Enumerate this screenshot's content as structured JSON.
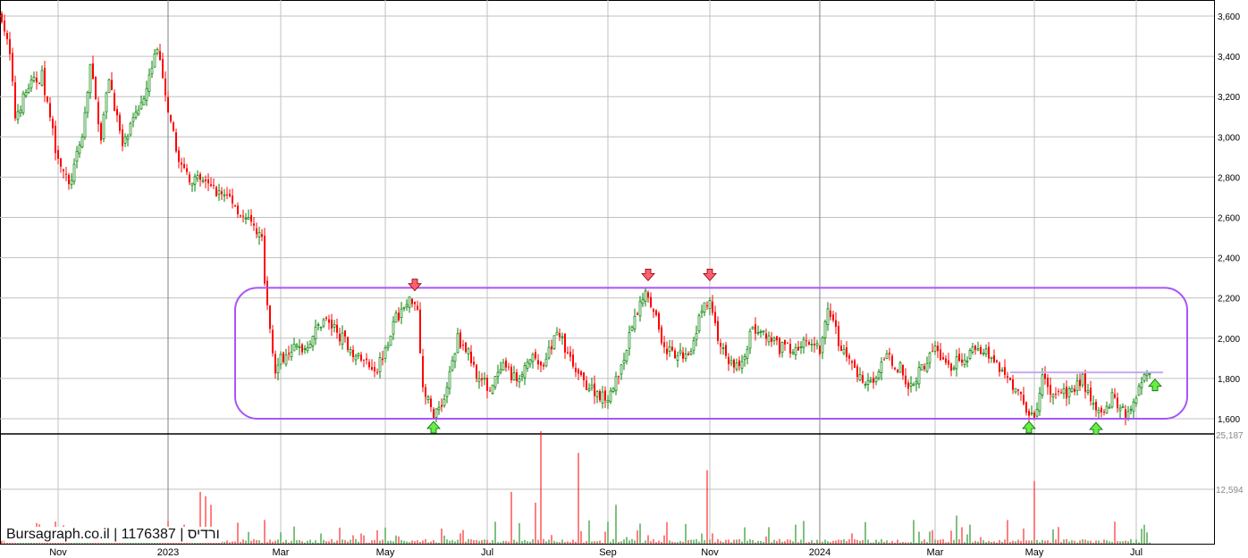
{
  "watermark": {
    "site": "Bursagraph.co.il",
    "security_id": "1176387",
    "name": "ורדיס",
    "separator": " | "
  },
  "chart_data": {
    "type": "candlestick",
    "title": "",
    "price_axis": {
      "ticks": [
        1600,
        1800,
        2000,
        2200,
        2400,
        2600,
        2800,
        3000,
        3200,
        3400,
        3600
      ],
      "labels": [
        "1,600",
        "1,800",
        "2,000",
        "2,200",
        "2,400",
        "2,600",
        "2,800",
        "3,000",
        "3,200",
        "3,400",
        "3,600"
      ],
      "range": [
        1540,
        3700
      ]
    },
    "volume_axis": {
      "ticks": [
        12594,
        25187
      ],
      "labels": [
        "12,594",
        "25,187"
      ],
      "max": 25187
    },
    "x_labels": [
      {
        "label": "Nov",
        "day": 21,
        "major": false
      },
      {
        "label": "2023",
        "day": 62,
        "major": true
      },
      {
        "label": "Mar",
        "day": 104,
        "major": false
      },
      {
        "label": "May",
        "day": 143,
        "major": false
      },
      {
        "label": "Jul",
        "day": 181,
        "major": false
      },
      {
        "label": "Sep",
        "day": 226,
        "major": false
      },
      {
        "label": "Nov",
        "day": 264,
        "major": false
      },
      {
        "label": "2024",
        "day": 305,
        "major": true
      },
      {
        "label": "Mar",
        "day": 348,
        "major": false
      },
      {
        "label": "May",
        "day": 385,
        "major": false
      },
      {
        "label": "Jul",
        "day": 423,
        "major": false
      }
    ],
    "x_unit": "trading day index",
    "close_keypoints": [
      [
        0,
        3600
      ],
      [
        3,
        3400
      ],
      [
        5,
        3100
      ],
      [
        10,
        3250
      ],
      [
        15,
        3300
      ],
      [
        20,
        2950
      ],
      [
        25,
        2750
      ],
      [
        30,
        3000
      ],
      [
        33,
        3350
      ],
      [
        37,
        3000
      ],
      [
        40,
        3300
      ],
      [
        45,
        2950
      ],
      [
        50,
        3100
      ],
      [
        55,
        3300
      ],
      [
        58,
        3450
      ],
      [
        62,
        3100
      ],
      [
        67,
        2850
      ],
      [
        70,
        2800
      ],
      [
        77,
        2750
      ],
      [
        85,
        2700
      ],
      [
        90,
        2600
      ],
      [
        97,
        2500
      ],
      [
        98,
        2250
      ],
      [
        102,
        1850
      ],
      [
        107,
        1950
      ],
      [
        113,
        1950
      ],
      [
        120,
        2100
      ],
      [
        127,
        2000
      ],
      [
        133,
        1900
      ],
      [
        140,
        1850
      ],
      [
        147,
        2100
      ],
      [
        153,
        2200
      ],
      [
        155,
        2150
      ],
      [
        157,
        1750
      ],
      [
        161,
        1620
      ],
      [
        165,
        1700
      ],
      [
        170,
        2000
      ],
      [
        173,
        1950
      ],
      [
        178,
        1800
      ],
      [
        182,
        1750
      ],
      [
        187,
        1850
      ],
      [
        192,
        1800
      ],
      [
        197,
        1900
      ],
      [
        202,
        1850
      ],
      [
        207,
        2050
      ],
      [
        210,
        1950
      ],
      [
        215,
        1800
      ],
      [
        220,
        1750
      ],
      [
        225,
        1700
      ],
      [
        230,
        1800
      ],
      [
        235,
        2050
      ],
      [
        240,
        2250
      ],
      [
        243,
        2150
      ],
      [
        247,
        1950
      ],
      [
        252,
        1900
      ],
      [
        257,
        1950
      ],
      [
        260,
        2100
      ],
      [
        264,
        2200
      ],
      [
        267,
        2000
      ],
      [
        270,
        1900
      ],
      [
        275,
        1850
      ],
      [
        280,
        2050
      ],
      [
        285,
        2000
      ],
      [
        290,
        1950
      ],
      [
        297,
        1950
      ],
      [
        302,
        2000
      ],
      [
        305,
        1950
      ],
      [
        308,
        2150
      ],
      [
        313,
        1950
      ],
      [
        320,
        1800
      ],
      [
        325,
        1800
      ],
      [
        330,
        1900
      ],
      [
        335,
        1850
      ],
      [
        338,
        1750
      ],
      [
        343,
        1850
      ],
      [
        348,
        1950
      ],
      [
        353,
        1850
      ],
      [
        358,
        1900
      ],
      [
        365,
        1950
      ],
      [
        370,
        1900
      ],
      [
        375,
        1800
      ],
      [
        380,
        1700
      ],
      [
        385,
        1600
      ],
      [
        388,
        1800
      ],
      [
        393,
        1700
      ],
      [
        400,
        1750
      ],
      [
        403,
        1800
      ],
      [
        408,
        1620
      ],
      [
        414,
        1700
      ],
      [
        418,
        1650
      ],
      [
        420,
        1620
      ],
      [
        425,
        1800
      ],
      [
        428,
        1850
      ]
    ],
    "volume_spikes": [
      [
        14,
        4500
      ],
      [
        74,
        12000
      ],
      [
        76,
        11000
      ],
      [
        78,
        9000
      ],
      [
        98,
        5500
      ],
      [
        190,
        12000
      ],
      [
        199,
        9500
      ],
      [
        201,
        26000
      ],
      [
        215,
        21000
      ],
      [
        229,
        9000
      ],
      [
        263,
        17000
      ],
      [
        385,
        14500
      ],
      [
        356,
        6500
      ],
      [
        340,
        5500
      ]
    ],
    "annotations": {
      "range_box": {
        "low": 1600,
        "high": 2250,
        "from_day": 87,
        "to_day": 442
      },
      "resistance_line": {
        "price": 1830,
        "from_day": 376,
        "to_day": 433
      },
      "sell_arrows": [
        [
          154,
          2240
        ],
        [
          241,
          2290
        ],
        [
          264,
          2290
        ]
      ],
      "buy_arrows": [
        [
          161,
          1560
        ],
        [
          383,
          1560
        ],
        [
          408,
          1555
        ],
        [
          430,
          1770
        ]
      ]
    },
    "colors": {
      "up": "#008000",
      "down": "#ff0000",
      "box": "#a855f7",
      "grid": "#c0c0c0",
      "major_grid": "#808080"
    }
  }
}
